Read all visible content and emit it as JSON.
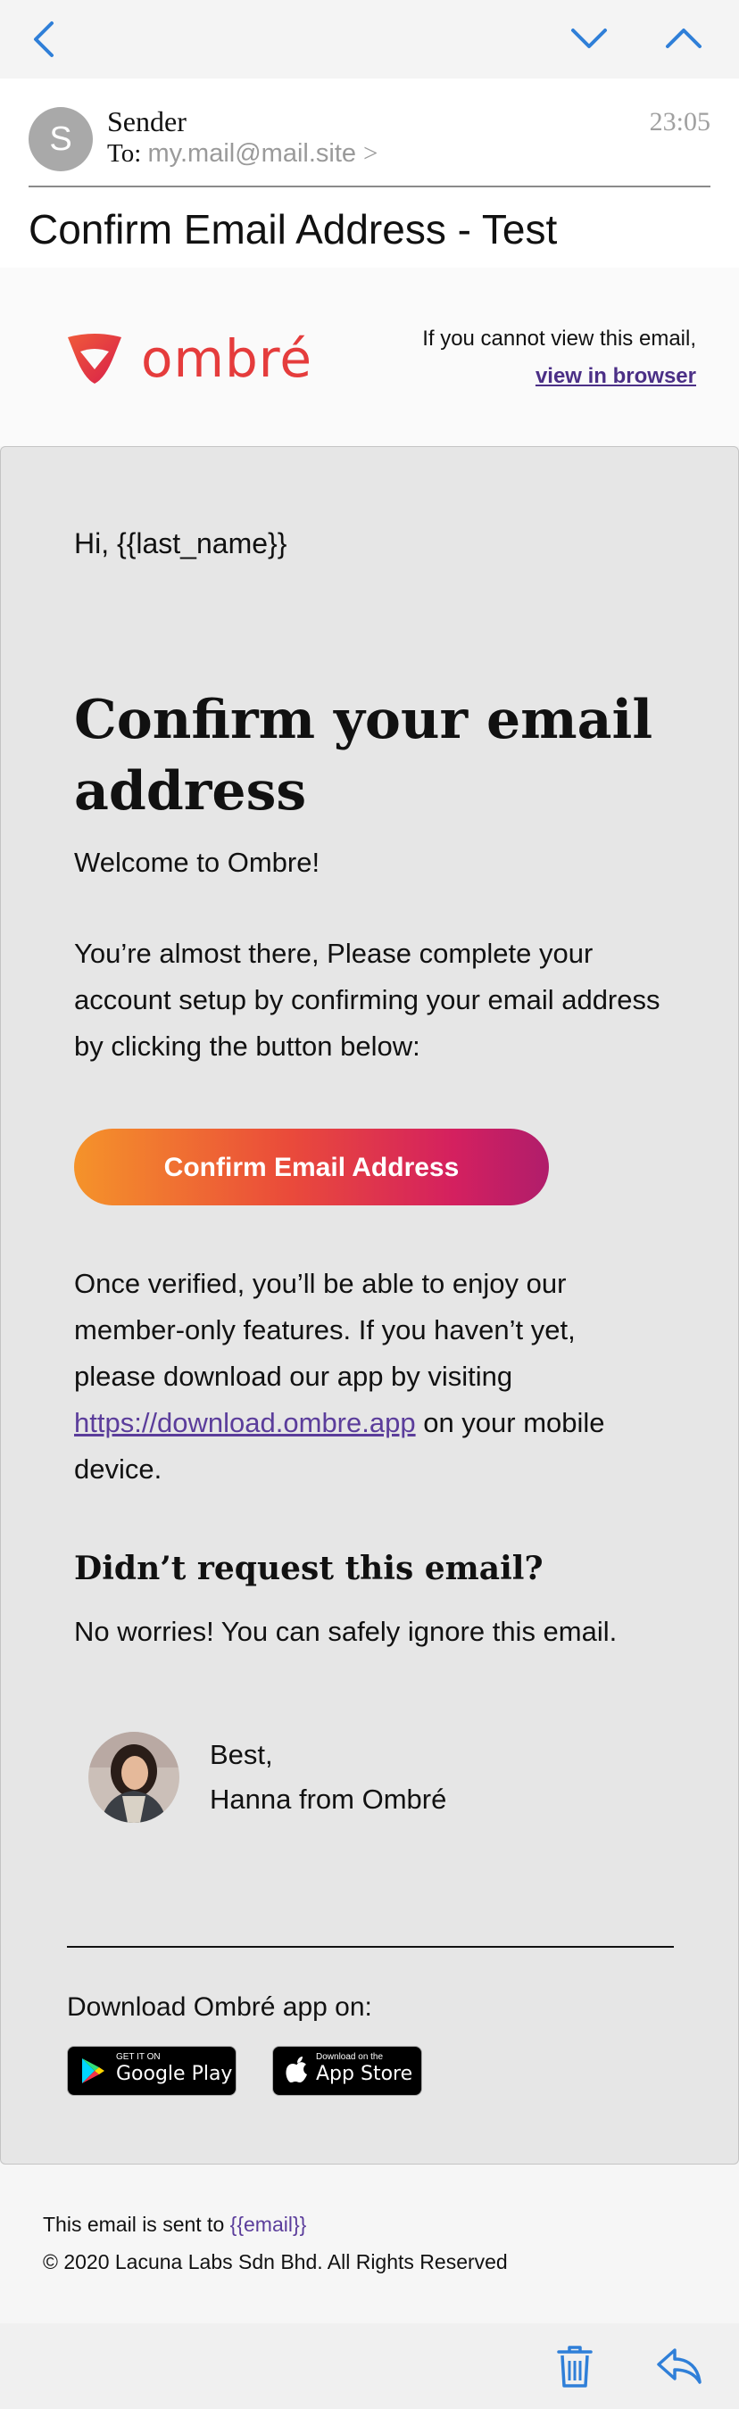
{
  "nav": {
    "back_icon": "chevron-left-icon",
    "down_icon": "chevron-down-icon",
    "up_icon": "chevron-up-icon",
    "accent": "#2f7fd8"
  },
  "header": {
    "avatar_letter": "S",
    "sender": "Sender",
    "to_label": "To:",
    "to_address": "my.mail@mail.site",
    "to_chevron": ">",
    "time": "23:05",
    "subject": "Confirm Email Address - Test"
  },
  "brand": {
    "logo_text": "ombré",
    "cannot_view": "If you cannot view this email,",
    "view_in_browser": "view in browser",
    "color": "#e53c3c"
  },
  "email": {
    "greeting": "Hi, {{last_name}}",
    "heading": "Confirm your email address",
    "welcome": "Welcome to Ombre!",
    "paragraph1": "You’re almost there, Please complete your account setup by confirming your email address by clicking the button below:",
    "confirm_button": "Confirm Email Address",
    "paragraph2_before": "Once verified, you’ll be able to enjoy our member-only features. If you haven’t yet, please download our app by visiting ",
    "download_link": "https://download.ombre.app",
    "paragraph2_after": " on your mobile device.",
    "didnt_request": "Didn’t request this email?",
    "no_worries": "No worries! You can safely ignore this email.",
    "best": "Best,",
    "signature": "Hanna from Ombré",
    "download_app": "Download Ombré app on:",
    "google_play_small": "GET IT ON",
    "google_play": "Google Play",
    "app_store_small": "Download on the",
    "app_store": "App Store"
  },
  "footer": {
    "sent_to": "This email is sent to ",
    "email_placeholder": "{{email}}",
    "copyright": "© 2020 Lacuna Labs Sdn Bhd. All Rights Reserved"
  },
  "toolbar": {
    "trash_icon": "trash-icon",
    "reply_icon": "reply-icon"
  }
}
